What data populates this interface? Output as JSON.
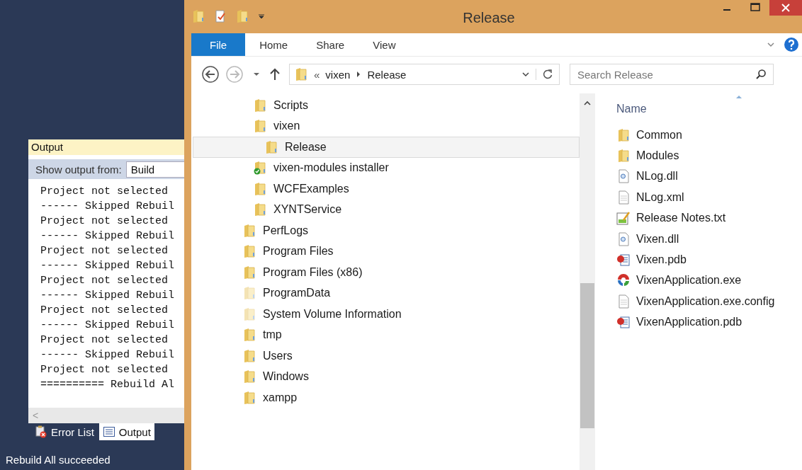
{
  "output_panel": {
    "title": "Output",
    "source_label": "Show output from:",
    "source_value": "Build",
    "lines": [
      "Project not selected",
      "------ Skipped Rebuil",
      "Project not selected",
      "------ Skipped Rebuil",
      "Project not selected",
      "------ Skipped Rebuil",
      "Project not selected",
      "------ Skipped Rebuil",
      "Project not selected",
      "------ Skipped Rebuil",
      "Project not selected",
      "------ Skipped Rebuil",
      "Project not selected",
      "========== Rebuild Al"
    ],
    "scroll_left": "<",
    "tabs": [
      {
        "label": "Error List",
        "kind": "errors",
        "selected": false
      },
      {
        "label": "Output",
        "kind": "output",
        "selected": true
      }
    ]
  },
  "status_bar": "Rebuild All succeeded",
  "explorer": {
    "title": "Release",
    "ribbon_tabs": [
      {
        "label": "File",
        "selected": true
      },
      {
        "label": "Home",
        "selected": false
      },
      {
        "label": "Share",
        "selected": false
      },
      {
        "label": "View",
        "selected": false
      }
    ],
    "address": {
      "prefix": "«",
      "crumbs": [
        "vixen",
        "Release"
      ]
    },
    "search": {
      "placeholder": "Search Release"
    },
    "nav_tree": {
      "clipped_branch": [
        {
          "label": "Scripts",
          "kind": "folder",
          "selected": false
        },
        {
          "label": "vixen",
          "kind": "folder",
          "selected": false,
          "children": [
            {
              "label": "Release",
              "kind": "folder",
              "selected": true
            }
          ]
        },
        {
          "label": "vixen-modules installer",
          "kind": "synced",
          "selected": false
        },
        {
          "label": "WCFExamples",
          "kind": "folder",
          "selected": false
        },
        {
          "label": "XYNTService",
          "kind": "folder",
          "selected": false
        }
      ],
      "items": [
        {
          "label": "PerfLogs",
          "kind": "folder",
          "selected": false
        },
        {
          "label": "Program Files",
          "kind": "folder",
          "selected": false
        },
        {
          "label": "Program Files (x86)",
          "kind": "folder",
          "selected": false
        },
        {
          "label": "ProgramData",
          "kind": "hidden",
          "selected": false
        },
        {
          "label": "System Volume Information",
          "kind": "hidden",
          "selected": false
        },
        {
          "label": "tmp",
          "kind": "folder",
          "selected": false
        },
        {
          "label": "Users",
          "kind": "folder",
          "selected": false
        },
        {
          "label": "Windows",
          "kind": "folder",
          "selected": false
        },
        {
          "label": "xampp",
          "kind": "folder",
          "selected": false
        }
      ]
    },
    "file_list": {
      "column": "Name",
      "files": [
        {
          "name": "Common",
          "kind": "folder"
        },
        {
          "name": "Modules",
          "kind": "folder"
        },
        {
          "name": "NLog.dll",
          "kind": "dll"
        },
        {
          "name": "NLog.xml",
          "kind": "text"
        },
        {
          "name": "Release Notes.txt",
          "kind": "notes"
        },
        {
          "name": "Vixen.dll",
          "kind": "dll"
        },
        {
          "name": "Vixen.pdb",
          "kind": "pdb"
        },
        {
          "name": "VixenApplication.exe",
          "kind": "exe"
        },
        {
          "name": "VixenApplication.exe.config",
          "kind": "text"
        },
        {
          "name": "VixenApplication.pdb",
          "kind": "pdb"
        }
      ]
    }
  }
}
